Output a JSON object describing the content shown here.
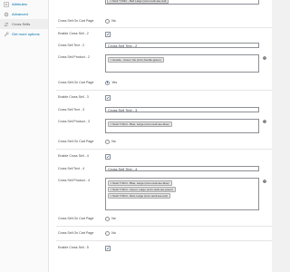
{
  "sidebar": {
    "items": [
      {
        "label": "Attributes",
        "icon": "attributes-icon"
      },
      {
        "label": "Advanced",
        "icon": "gear-icon"
      },
      {
        "label": "Cross Sells",
        "icon": "cross-sells-icon"
      },
      {
        "label": "Get more options",
        "icon": "wrench-icon"
      }
    ]
  },
  "top_partial_tag": "× Neck T-Shirt - Red Large (xxxx-neck-tee-red)",
  "cross_sell_on_cart_prefix": {
    "label": "Cross Sell On Cart Page",
    "option": "No"
  },
  "groups": [
    {
      "enable_label": "Enable Cross Sell - 2",
      "text_label": "Cross Sell Text - 2",
      "text_value": "Cross Sell Text - 2",
      "product_label": "Cross Sell Product - 2",
      "products": [
        "× Hoodie - Green, No (xxxx-hoodie-green)"
      ],
      "cart_label": "Cross Sell On Cart Page",
      "cart_option": "Yes"
    },
    {
      "enable_label": "Enable Cross Sell - 3",
      "text_label": "Cross Sell Text - 3",
      "text_value": "Cross Sell Text - 3",
      "product_label": "Cross Sell Product - 3",
      "products": [
        "× Neck T-Shirt - Blue, Large (xxxx-neck-tee-blue)"
      ],
      "cart_label": "Cross Sell On Cart Page",
      "cart_option": "No"
    },
    {
      "enable_label": "Enable Cross Sell - 4",
      "text_label": "Cross Sell Text - 4",
      "text_value": "Cross Sell Text - 4",
      "product_label": "Cross Sell Product - 4",
      "products": [
        "× Neck T-Shirt - Blue, Large (xxxx-neck-tee-blue)",
        "× Neck T-Shirt - Green, Large (xxxx-neck-tee-green)",
        "× Neck T-Shirt - Red, Large (xxxx-neck-tee-red)"
      ],
      "cart_label": "Cross Sell On Cart Page",
      "cart_option": "No"
    }
  ],
  "bottom": {
    "cart_label": "Cross Sell On Cart Page",
    "cart_option": "No",
    "enable_label": "Enable Cross Sell - 5"
  },
  "colors": {
    "accent": "#2271b1",
    "link": "#0073aa"
  }
}
